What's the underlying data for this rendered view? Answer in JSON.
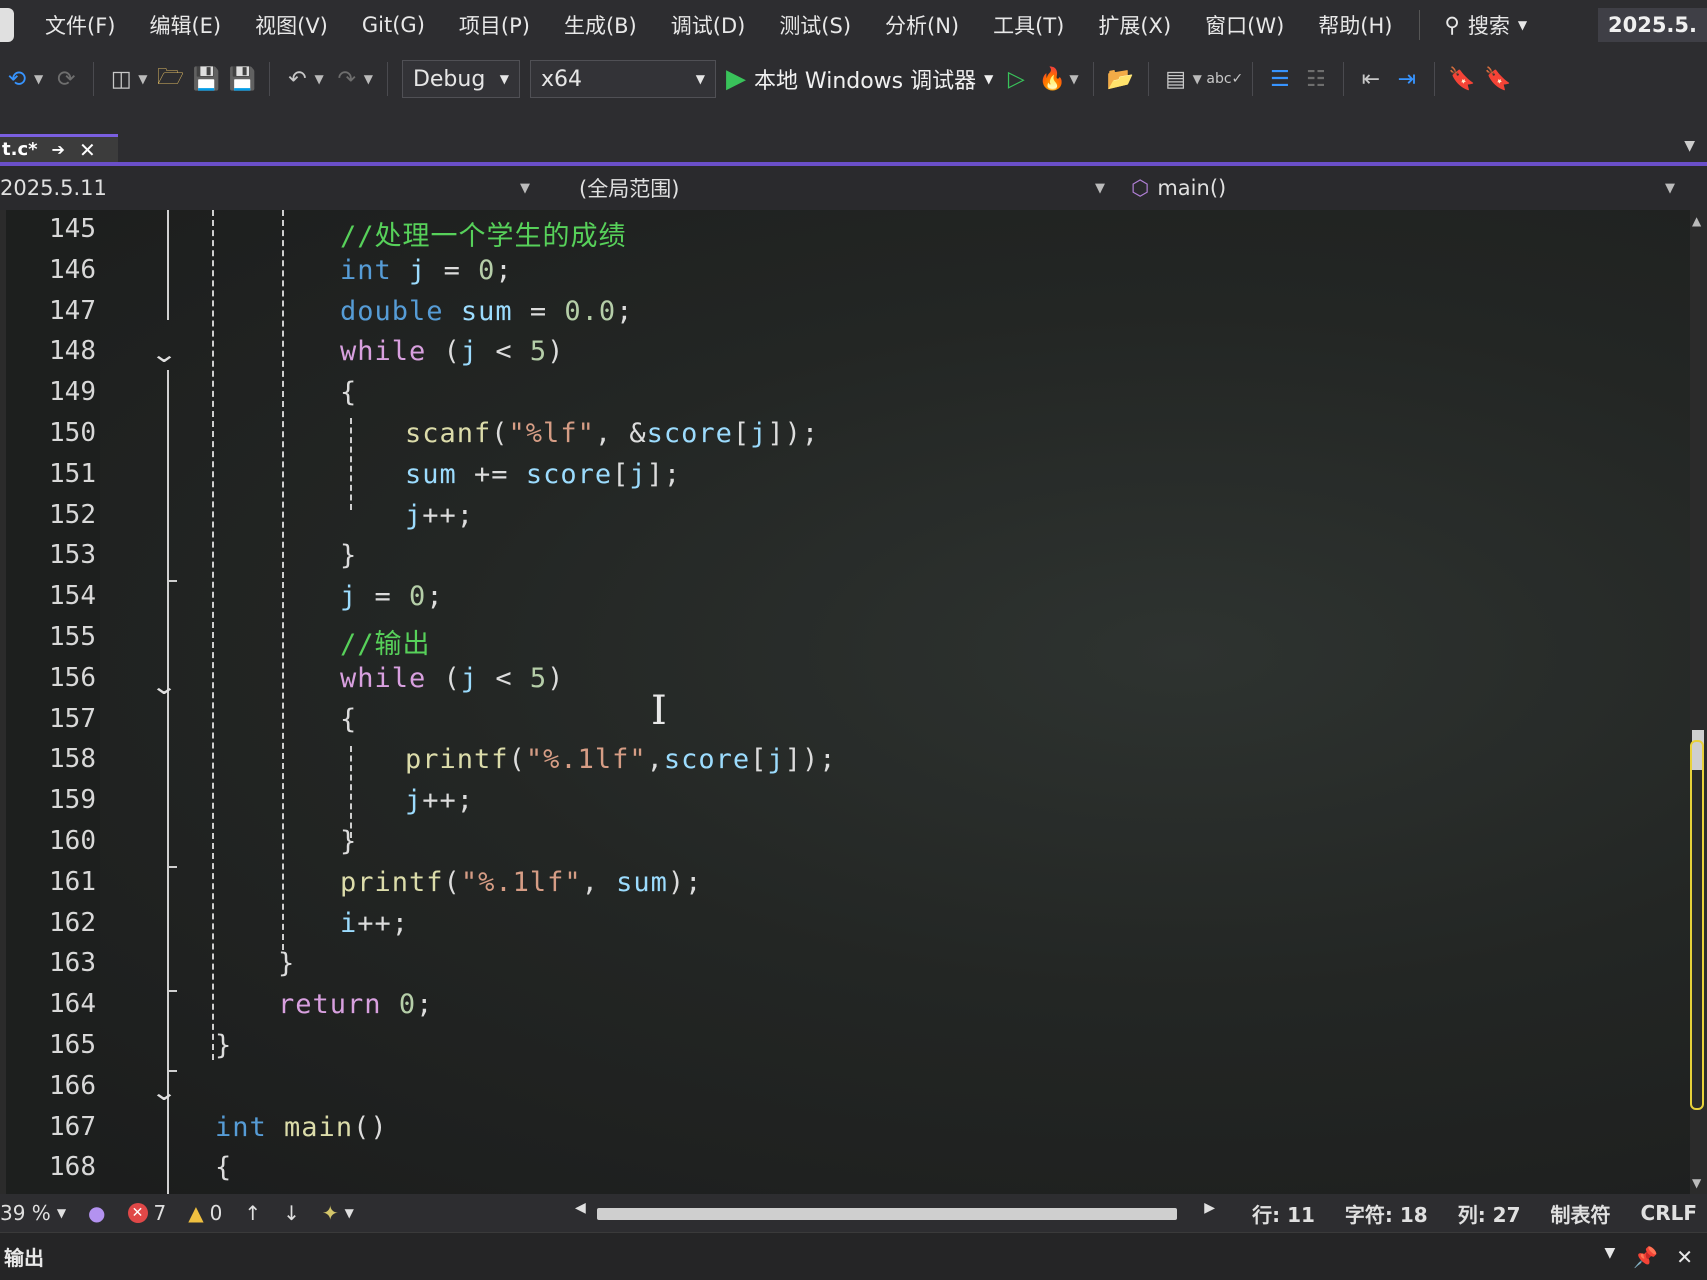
{
  "menubar": {
    "items": [
      "文件(F)",
      "编辑(E)",
      "视图(V)",
      "Git(G)",
      "项目(P)",
      "生成(B)",
      "调试(D)",
      "测试(S)",
      "分析(N)",
      "工具(T)",
      "扩展(X)",
      "窗口(W)",
      "帮助(H)"
    ],
    "search_label": "搜索",
    "title": "2025.5."
  },
  "toolbar": {
    "configuration": "Debug",
    "platform": "x64",
    "run_label": "本地 Windows 调试器"
  },
  "tab": {
    "label": "t.c*"
  },
  "navbar": {
    "project": "2025.5.11",
    "scope": "(全局范围)",
    "member": "main()"
  },
  "editor": {
    "line_numbers": [
      "145",
      "146",
      "147",
      "148",
      "149",
      "150",
      "151",
      "152",
      "153",
      "154",
      "155",
      "156",
      "157",
      "158",
      "159",
      "160",
      "161",
      "162",
      "163",
      "164",
      "165",
      "166",
      "167",
      "168"
    ],
    "lines": [
      {
        "indent": 3,
        "tokens": [
          {
            "t": "//处理一个学生的成绩",
            "c": "cm"
          }
        ]
      },
      {
        "indent": 3,
        "tokens": [
          {
            "t": "int",
            "c": "kw"
          },
          {
            "t": " "
          },
          {
            "t": "j",
            "c": "var"
          },
          {
            "t": " = "
          },
          {
            "t": "0",
            "c": "num"
          },
          {
            "t": ";"
          }
        ]
      },
      {
        "indent": 3,
        "tokens": [
          {
            "t": "double",
            "c": "kw"
          },
          {
            "t": " "
          },
          {
            "t": "sum",
            "c": "var"
          },
          {
            "t": " = "
          },
          {
            "t": "0.0",
            "c": "num"
          },
          {
            "t": ";"
          }
        ]
      },
      {
        "indent": 3,
        "tokens": [
          {
            "t": "while",
            "c": "ctl"
          },
          {
            "t": " ("
          },
          {
            "t": "j",
            "c": "var"
          },
          {
            "t": " < "
          },
          {
            "t": "5",
            "c": "num"
          },
          {
            "t": ")"
          }
        ]
      },
      {
        "indent": 3,
        "tokens": [
          {
            "t": "{"
          }
        ]
      },
      {
        "indent": 4,
        "tokens": [
          {
            "t": "scanf",
            "c": "fn"
          },
          {
            "t": "("
          },
          {
            "t": "\"%lf\"",
            "c": "str"
          },
          {
            "t": ", &"
          },
          {
            "t": "score",
            "c": "var"
          },
          {
            "t": "["
          },
          {
            "t": "j",
            "c": "var"
          },
          {
            "t": "]);"
          }
        ]
      },
      {
        "indent": 4,
        "tokens": [
          {
            "t": "sum",
            "c": "var"
          },
          {
            "t": " += "
          },
          {
            "t": "score",
            "c": "var"
          },
          {
            "t": "["
          },
          {
            "t": "j",
            "c": "var"
          },
          {
            "t": "];"
          }
        ]
      },
      {
        "indent": 4,
        "tokens": [
          {
            "t": "j",
            "c": "var"
          },
          {
            "t": "++;"
          }
        ]
      },
      {
        "indent": 3,
        "tokens": [
          {
            "t": "}"
          }
        ]
      },
      {
        "indent": 3,
        "tokens": [
          {
            "t": "j",
            "c": "var"
          },
          {
            "t": " = "
          },
          {
            "t": "0",
            "c": "num"
          },
          {
            "t": ";"
          }
        ]
      },
      {
        "indent": 3,
        "tokens": [
          {
            "t": "//输出",
            "c": "cm"
          }
        ]
      },
      {
        "indent": 3,
        "tokens": [
          {
            "t": "while",
            "c": "ctl"
          },
          {
            "t": " ("
          },
          {
            "t": "j",
            "c": "var"
          },
          {
            "t": " < "
          },
          {
            "t": "5",
            "c": "num"
          },
          {
            "t": ")"
          }
        ]
      },
      {
        "indent": 3,
        "tokens": [
          {
            "t": "{"
          }
        ]
      },
      {
        "indent": 4,
        "tokens": [
          {
            "t": "printf",
            "c": "fn"
          },
          {
            "t": "("
          },
          {
            "t": "\"%.1lf\"",
            "c": "str"
          },
          {
            "t": ","
          },
          {
            "t": "score",
            "c": "var"
          },
          {
            "t": "["
          },
          {
            "t": "j",
            "c": "var"
          },
          {
            "t": "]);"
          }
        ]
      },
      {
        "indent": 4,
        "tokens": [
          {
            "t": "j",
            "c": "var"
          },
          {
            "t": "++;"
          }
        ]
      },
      {
        "indent": 3,
        "tokens": [
          {
            "t": "}"
          }
        ]
      },
      {
        "indent": 3,
        "tokens": [
          {
            "t": "printf",
            "c": "fn"
          },
          {
            "t": "("
          },
          {
            "t": "\"%.1lf\"",
            "c": "str"
          },
          {
            "t": ", "
          },
          {
            "t": "sum",
            "c": "var"
          },
          {
            "t": ");"
          }
        ]
      },
      {
        "indent": 3,
        "tokens": [
          {
            "t": "i",
            "c": "var"
          },
          {
            "t": "++;"
          }
        ]
      },
      {
        "indent": 2,
        "tokens": [
          {
            "t": "}"
          }
        ]
      },
      {
        "indent": 2,
        "tokens": [
          {
            "t": "return",
            "c": "ctl"
          },
          {
            "t": " "
          },
          {
            "t": "0",
            "c": "num"
          },
          {
            "t": ";"
          }
        ]
      },
      {
        "indent": 1,
        "tokens": [
          {
            "t": "}"
          }
        ]
      },
      {
        "indent": 0,
        "tokens": []
      },
      {
        "indent": 1,
        "tokens": [
          {
            "t": "int",
            "c": "kw"
          },
          {
            "t": " "
          },
          {
            "t": "main",
            "c": "fn"
          },
          {
            "t": "()"
          }
        ]
      },
      {
        "indent": 1,
        "tokens": [
          {
            "t": "{"
          }
        ]
      }
    ]
  },
  "status": {
    "zoom": "39 %",
    "errors": "7",
    "warnings": "0",
    "line": "行: 11",
    "char": "字符: 18",
    "col": "列: 27",
    "tabs": "制表符",
    "eol": "CRLF"
  },
  "output": {
    "label": "输出"
  },
  "colors": {
    "accent": "#6a4fc9",
    "comment": "#57d15a",
    "keyword": "#569cd6",
    "control": "#d8a0df",
    "function": "#dcdcaa"
  }
}
